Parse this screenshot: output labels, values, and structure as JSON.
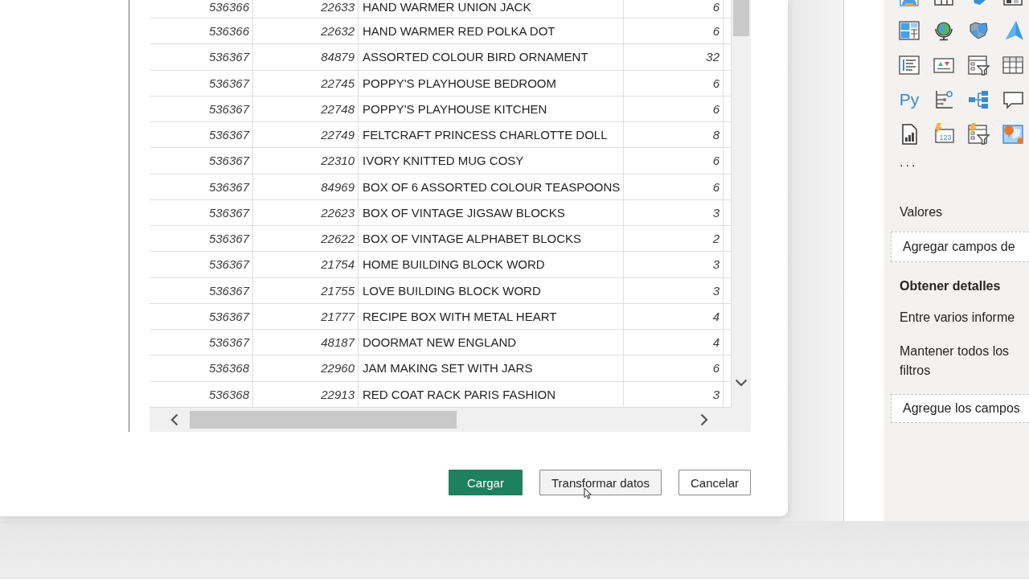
{
  "dialog": {
    "table": {
      "rows": [
        [
          "536366",
          "22633",
          "HAND WARMER UNION JACK",
          "6"
        ],
        [
          "536366",
          "22632",
          "HAND WARMER RED POLKA DOT",
          "6"
        ],
        [
          "536367",
          "84879",
          "ASSORTED COLOUR BIRD ORNAMENT",
          "32"
        ],
        [
          "536367",
          "22745",
          "POPPY'S PLAYHOUSE BEDROOM",
          "6"
        ],
        [
          "536367",
          "22748",
          "POPPY'S PLAYHOUSE KITCHEN",
          "6"
        ],
        [
          "536367",
          "22749",
          "FELTCRAFT PRINCESS CHARLOTTE DOLL",
          "8"
        ],
        [
          "536367",
          "22310",
          "IVORY KNITTED MUG COSY",
          "6"
        ],
        [
          "536367",
          "84969",
          "BOX OF 6 ASSORTED COLOUR TEASPOONS",
          "6"
        ],
        [
          "536367",
          "22623",
          "BOX OF VINTAGE JIGSAW BLOCKS",
          "3"
        ],
        [
          "536367",
          "22622",
          "BOX OF VINTAGE ALPHABET BLOCKS",
          "2"
        ],
        [
          "536367",
          "21754",
          "HOME BUILDING BLOCK WORD",
          "3"
        ],
        [
          "536367",
          "21755",
          "LOVE BUILDING BLOCK WORD",
          "3"
        ],
        [
          "536367",
          "21777",
          "RECIPE BOX WITH METAL HEART",
          "4"
        ],
        [
          "536367",
          "48187",
          "DOORMAT NEW ENGLAND",
          "4"
        ],
        [
          "536368",
          "22960",
          "JAM MAKING SET WITH JARS",
          "6"
        ],
        [
          "536368",
          "22913",
          "RED COAT RACK PARIS FASHION",
          "3"
        ]
      ]
    },
    "buttons": [
      {
        "label": "Cargar",
        "kind": "primary",
        "hovered": false
      },
      {
        "label": "Transformar datos",
        "kind": "default",
        "hovered": true
      },
      {
        "label": "Cancelar",
        "kind": "default",
        "hovered": false
      }
    ]
  },
  "visualizations_pane": {
    "visuals": [
      {
        "kind": "gauge"
      },
      {
        "kind": "frame"
      },
      {
        "kind": "map-shape"
      },
      {
        "kind": "card"
      },
      {
        "kind": "treemap"
      },
      {
        "kind": "globe"
      },
      {
        "kind": "filled-map"
      },
      {
        "kind": "navigation"
      },
      {
        "kind": "list"
      },
      {
        "kind": "kpi"
      },
      {
        "kind": "slicer"
      },
      {
        "kind": "table"
      },
      {
        "kind": "text",
        "label": "Py"
      },
      {
        "kind": "influencers"
      },
      {
        "kind": "tree"
      },
      {
        "kind": "bubble"
      },
      {
        "kind": "report"
      },
      {
        "kind": "number-card",
        "label": "123"
      },
      {
        "kind": "lightning-filter"
      },
      {
        "kind": "pin-map"
      }
    ],
    "more": "...",
    "values": {
      "label": "Valores",
      "well": "Agregar campos de"
    },
    "drillthrough": {
      "title": "Obtener detalles",
      "options": [
        "Entre varios informe",
        "Mantener todos los filtros"
      ],
      "well": "Agregue los campos"
    }
  }
}
